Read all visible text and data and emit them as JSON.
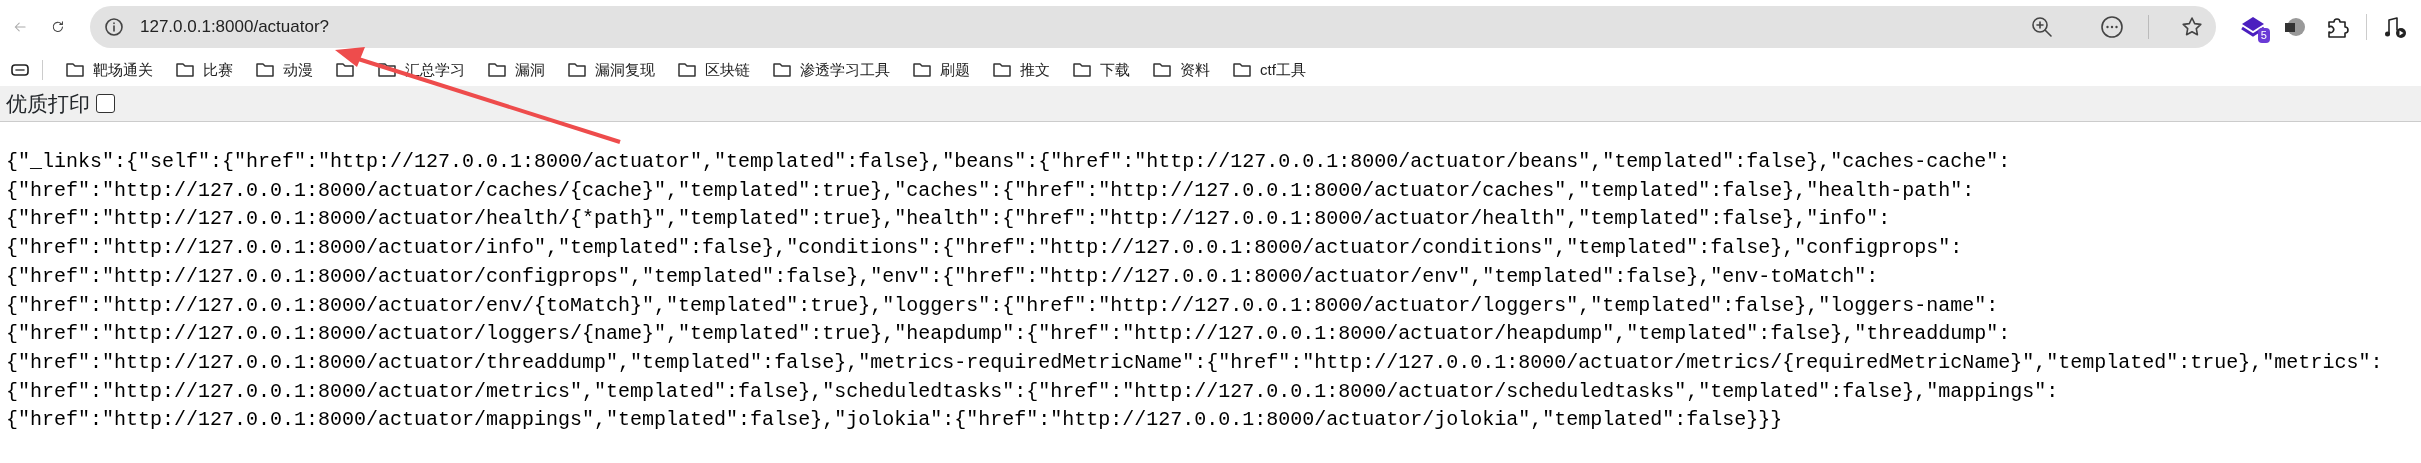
{
  "browser": {
    "address": "127.0.0.1:8000/actuator?",
    "extension_badge": "5"
  },
  "bookmarks": [
    {
      "kind": "folder",
      "label": "靶场通关"
    },
    {
      "kind": "folder",
      "label": "比赛"
    },
    {
      "kind": "folder",
      "label": "动漫"
    },
    {
      "kind": "folder"
    },
    {
      "kind": "folder",
      "label": "汇总学习"
    },
    {
      "kind": "folder",
      "label": "漏洞"
    },
    {
      "kind": "folder",
      "label": "漏洞复现"
    },
    {
      "kind": "folder",
      "label": "区块链"
    },
    {
      "kind": "folder",
      "label": "渗透学习工具"
    },
    {
      "kind": "folder",
      "label": "刷题"
    },
    {
      "kind": "folder",
      "label": "推文"
    },
    {
      "kind": "folder",
      "label": "下载"
    },
    {
      "kind": "folder",
      "label": "资料"
    },
    {
      "kind": "folder",
      "label": "ctf工具"
    }
  ],
  "print_bar": {
    "label": "优质打印",
    "checked": false
  },
  "json_lines": [
    "{\"_links\":{\"self\":{\"href\":\"http://127.0.0.1:8000/actuator\",\"templated\":false},\"beans\":{\"href\":\"http://127.0.0.1:8000/actuator/beans\",\"templated\":false},\"caches-cache\":",
    "{\"href\":\"http://127.0.0.1:8000/actuator/caches/{cache}\",\"templated\":true},\"caches\":{\"href\":\"http://127.0.0.1:8000/actuator/caches\",\"templated\":false},\"health-path\":",
    "{\"href\":\"http://127.0.0.1:8000/actuator/health/{*path}\",\"templated\":true},\"health\":{\"href\":\"http://127.0.0.1:8000/actuator/health\",\"templated\":false},\"info\":",
    "{\"href\":\"http://127.0.0.1:8000/actuator/info\",\"templated\":false},\"conditions\":{\"href\":\"http://127.0.0.1:8000/actuator/conditions\",\"templated\":false},\"configprops\":",
    "{\"href\":\"http://127.0.0.1:8000/actuator/configprops\",\"templated\":false},\"env\":{\"href\":\"http://127.0.0.1:8000/actuator/env\",\"templated\":false},\"env-toMatch\":",
    "{\"href\":\"http://127.0.0.1:8000/actuator/env/{toMatch}\",\"templated\":true},\"loggers\":{\"href\":\"http://127.0.0.1:8000/actuator/loggers\",\"templated\":false},\"loggers-name\":",
    "{\"href\":\"http://127.0.0.1:8000/actuator/loggers/{name}\",\"templated\":true},\"heapdump\":{\"href\":\"http://127.0.0.1:8000/actuator/heapdump\",\"templated\":false},\"threaddump\":",
    "{\"href\":\"http://127.0.0.1:8000/actuator/threaddump\",\"templated\":false},\"metrics-requiredMetricName\":{\"href\":\"http://127.0.0.1:8000/actuator/metrics/{requiredMetricName}\",\"templated\":true},\"metrics\":",
    "{\"href\":\"http://127.0.0.1:8000/actuator/metrics\",\"templated\":false},\"scheduledtasks\":{\"href\":\"http://127.0.0.1:8000/actuator/scheduledtasks\",\"templated\":false},\"mappings\":",
    "{\"href\":\"http://127.0.0.1:8000/actuator/mappings\",\"templated\":false},\"jolokia\":{\"href\":\"http://127.0.0.1:8000/actuator/jolokia\",\"templated\":false}}}"
  ]
}
